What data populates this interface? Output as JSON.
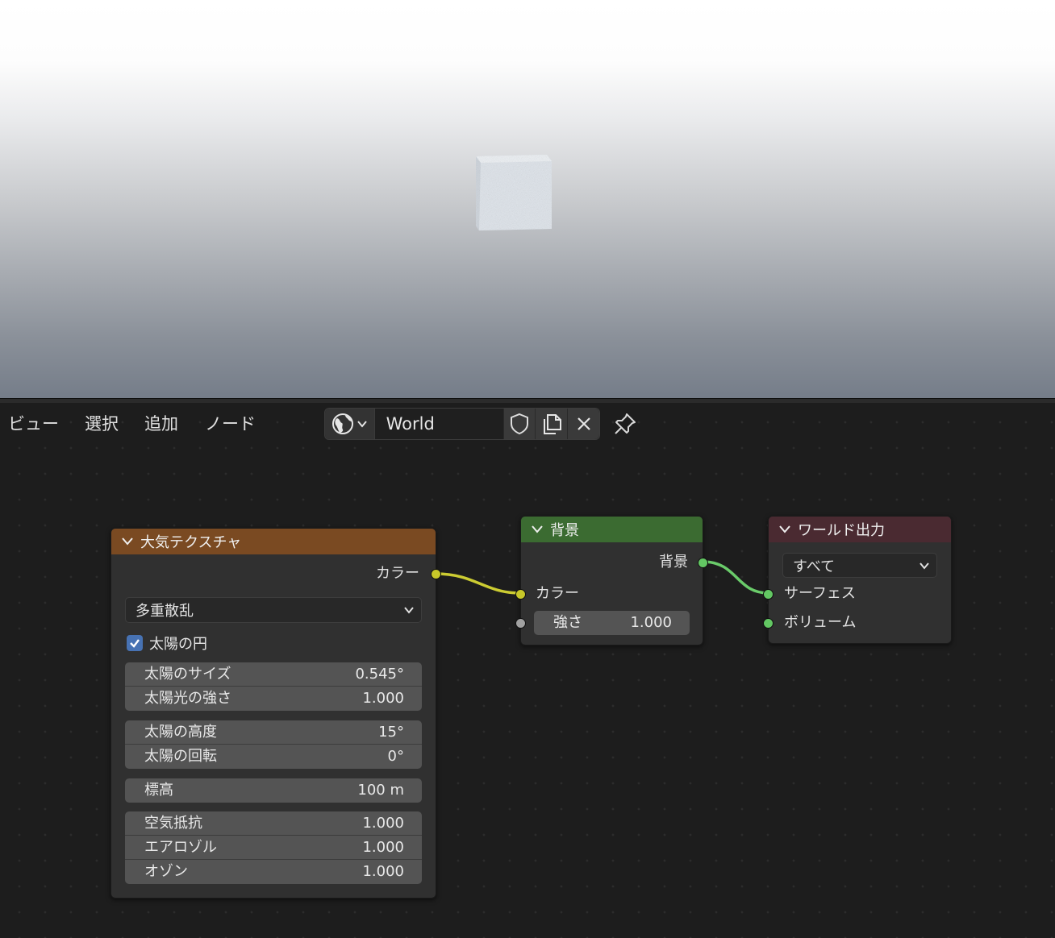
{
  "header": {
    "menu": [
      "ビュー",
      "選択",
      "追加",
      "ノード"
    ],
    "world_name": "World"
  },
  "nodes": {
    "sky": {
      "title": "大気テクスチャ",
      "output_label": "カラー",
      "sky_type": "多重散乱",
      "sun_disc_label": "太陽の円",
      "sun_disc_checked": true,
      "groups": [
        [
          {
            "label": "太陽のサイズ",
            "value": "0.545°"
          },
          {
            "label": "太陽光の強さ",
            "value": "1.000"
          }
        ],
        [
          {
            "label": "太陽の高度",
            "value": "15°"
          },
          {
            "label": "太陽の回転",
            "value": "0°"
          }
        ],
        [
          {
            "label": "標高",
            "value": "100 m"
          }
        ],
        [
          {
            "label": "空気抵抗",
            "value": "1.000"
          },
          {
            "label": "エアロゾル",
            "value": "1.000"
          },
          {
            "label": "オゾン",
            "value": "1.000"
          }
        ]
      ]
    },
    "background": {
      "title": "背景",
      "output_label": "背景",
      "color_label": "カラー",
      "strength_label": "強さ",
      "strength_value": "1.000"
    },
    "world_output": {
      "title": "ワールド出力",
      "target": "すべて",
      "surface_label": "サーフェス",
      "volume_label": "ボリューム"
    }
  },
  "colors": {
    "sky_header": "#7a4a22",
    "background_header": "#3b6b31",
    "output_header": "#4a2a31",
    "socket_color": "#c7c729",
    "socket_shader": "#63c763",
    "socket_float": "#a1a1a1",
    "checkbox": "#4772b3"
  },
  "icons": {
    "world_type": "world-globe-icon",
    "fake_user": "shield-icon",
    "duplicate": "duplicate-icon",
    "unlink": "close-icon",
    "pin": "pin-icon"
  }
}
